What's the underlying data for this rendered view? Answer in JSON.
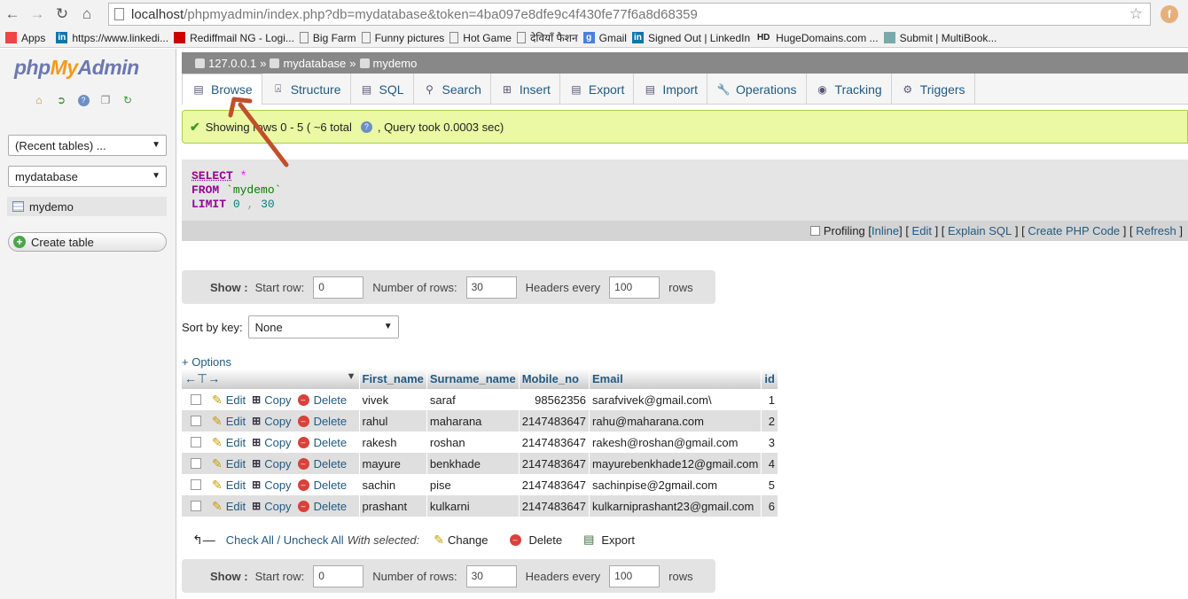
{
  "browser": {
    "url_host": "localhost",
    "url_path": "/phpmyadmin/index.php?db=mydatabase&token=4ba097e8dfe9c4f430fe77f6a8d68359",
    "bookmarks": [
      {
        "label": "Apps",
        "icon": "apps-grid-icon"
      },
      {
        "label": "https://www.linkedi...",
        "icon": "linkedin-icon"
      },
      {
        "label": "Rediffmail NG - Logi...",
        "icon": "rediffmail-icon"
      },
      {
        "label": "Big Farm",
        "icon": "page-icon"
      },
      {
        "label": "Funny pictures",
        "icon": "page-icon"
      },
      {
        "label": "Hot Game",
        "icon": "page-icon"
      },
      {
        "label": "देवियाँ फैशन",
        "icon": "page-icon"
      },
      {
        "label": "Gmail",
        "icon": "google-icon"
      },
      {
        "label": "Signed Out | LinkedIn",
        "icon": "linkedin-icon"
      },
      {
        "label": "HugeDomains.com ...",
        "icon": "hugedomains-icon"
      },
      {
        "label": "Submit | MultiBook...",
        "icon": "multibook-icon"
      }
    ],
    "extension_letter": "f"
  },
  "sidebar": {
    "logo": {
      "php": "php",
      "my": "My",
      "admin": "Admin"
    },
    "recent_tables": "(Recent tables) ...",
    "database": "mydatabase",
    "table": "mydemo",
    "create_table": "Create table"
  },
  "breadcrumb": {
    "server": "127.0.0.1",
    "db": "mydatabase",
    "table": "mydemo",
    "sep": "»"
  },
  "tabs": [
    {
      "label": "Browse",
      "icon": "browse-icon",
      "active": true
    },
    {
      "label": "Structure",
      "icon": "structure-icon"
    },
    {
      "label": "SQL",
      "icon": "sql-icon"
    },
    {
      "label": "Search",
      "icon": "search-icon"
    },
    {
      "label": "Insert",
      "icon": "insert-icon"
    },
    {
      "label": "Export",
      "icon": "export-icon"
    },
    {
      "label": "Import",
      "icon": "import-icon"
    },
    {
      "label": "Operations",
      "icon": "wrench-icon"
    },
    {
      "label": "Tracking",
      "icon": "eye-icon"
    },
    {
      "label": "Triggers",
      "icon": "triggers-icon"
    }
  ],
  "message": {
    "text_before": "Showing rows 0 - 5 ( ~6 total",
    "text_after": ", Query took 0.0003 sec)"
  },
  "sql": {
    "select": "SELECT",
    "star": "*",
    "from": "FROM",
    "table": "`mydemo`",
    "limit": "LIMIT",
    "offset": "0",
    "comma": ",",
    "count": "30"
  },
  "sql_footer": {
    "profiling": "Profiling",
    "inline": "Inline",
    "edit": "Edit",
    "explain": "Explain SQL",
    "php": "Create PHP Code",
    "refresh": "Refresh"
  },
  "nav": {
    "show": "Show :",
    "start_row_label": "Start row:",
    "start_row": "0",
    "num_rows_label": "Number of rows:",
    "num_rows": "30",
    "headers_label": "Headers every",
    "headers": "100",
    "rows": "rows"
  },
  "sort": {
    "label": "Sort by key:",
    "value": "None"
  },
  "options_link": "+ Options",
  "table": {
    "columns": [
      "First_name",
      "Surname_name",
      "Mobile_no",
      "Email",
      "id"
    ],
    "action_labels": {
      "edit": "Edit",
      "copy": "Copy",
      "delete": "Delete"
    },
    "rows": [
      [
        "vivek",
        "saraf",
        "98562356",
        "sarafvivek@gmail.com\\",
        "1"
      ],
      [
        "rahul",
        "maharana",
        "2147483647",
        "rahu@maharana.com",
        "2"
      ],
      [
        "rakesh",
        "roshan",
        "2147483647",
        "rakesh@roshan@gmail.com",
        "3"
      ],
      [
        "mayure",
        "benkhade",
        "2147483647",
        "mayurebenkhade12@gmail.com",
        "4"
      ],
      [
        "sachin",
        "pise",
        "2147483647",
        "sachinpise@2gmail.com",
        "5"
      ],
      [
        "prashant",
        "kulkarni",
        "2147483647",
        "kulkarniprashant23@gmail.com",
        "6"
      ]
    ]
  },
  "bulk": {
    "check_all": "Check All / Uncheck All",
    "with_selected": "With selected:",
    "change": "Change",
    "delete": "Delete",
    "export": "Export"
  },
  "colors": {
    "link": "#235a81",
    "success_bg": "#ebf8a4",
    "arrow": "#c0502a"
  }
}
